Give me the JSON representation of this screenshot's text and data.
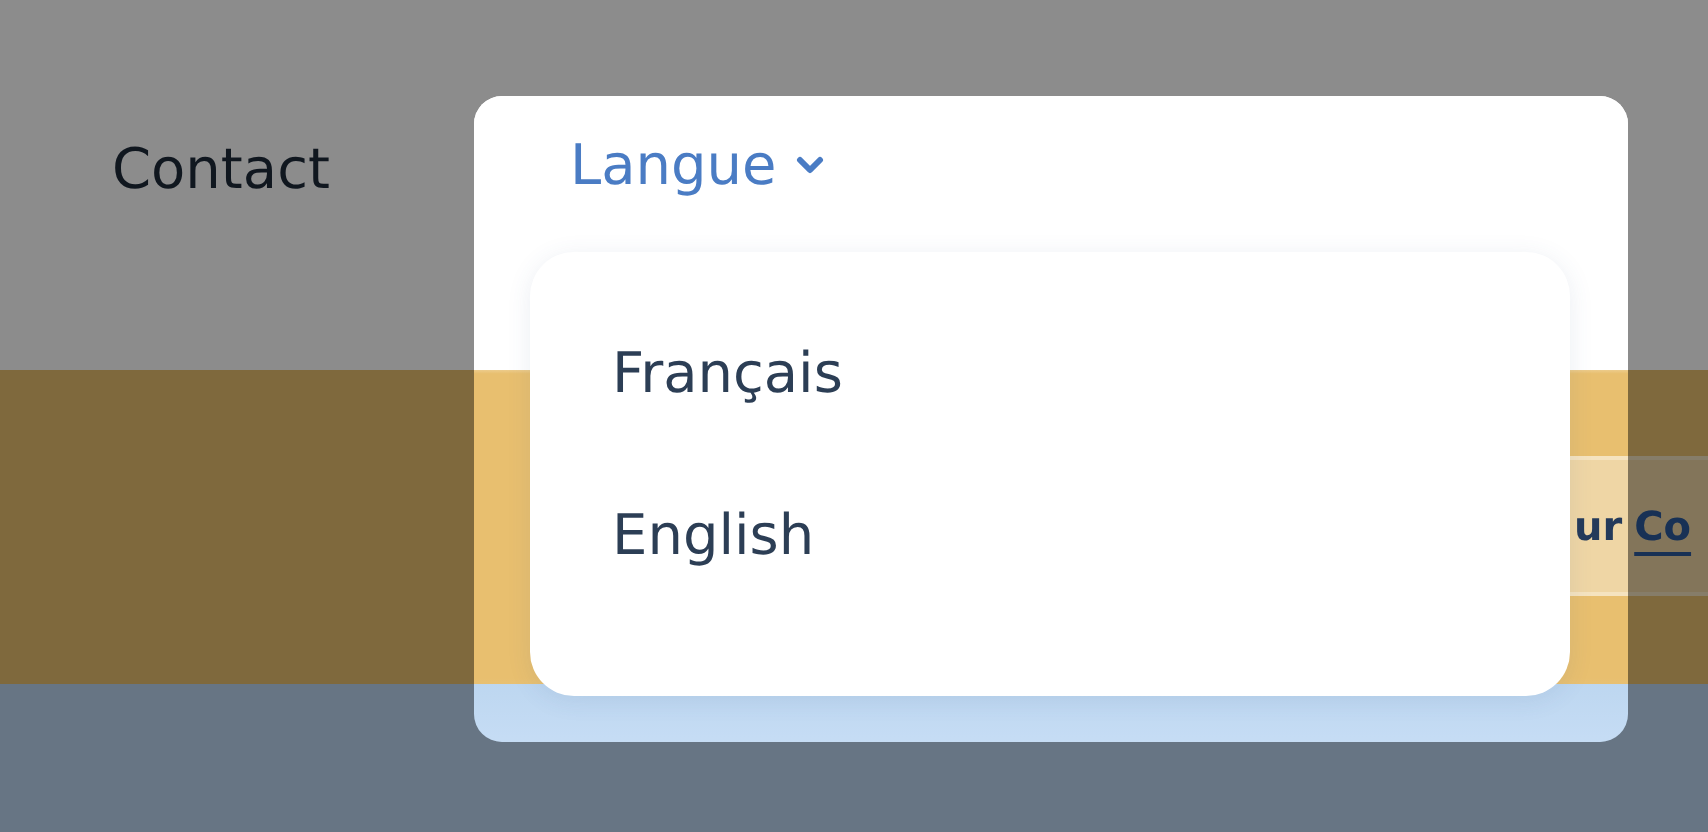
{
  "nav": {
    "link": "Contact"
  },
  "language_menu": {
    "label": "Langue",
    "expanded": true,
    "options": [
      {
        "label": "Français"
      },
      {
        "label": "English"
      }
    ]
  },
  "banner": {
    "text": "ur",
    "link": "Co"
  }
}
